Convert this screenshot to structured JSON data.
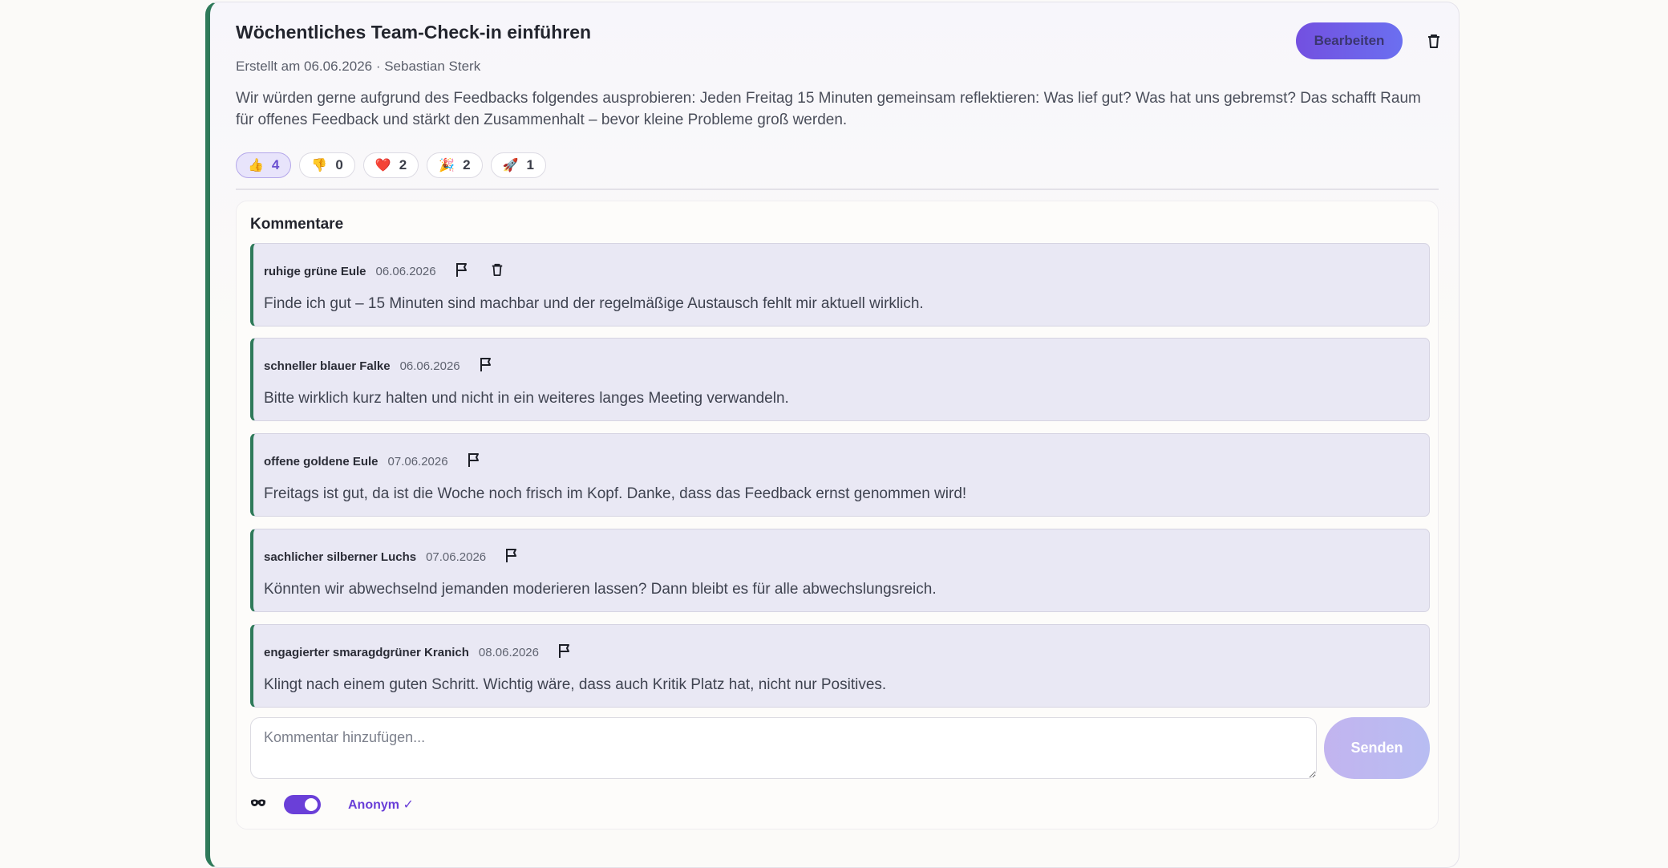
{
  "post": {
    "title": "Wöchentliches Team-Check-in einführen",
    "meta": "Erstellt am 06.06.2026 · Sebastian Sterk",
    "description": "Wir würden gerne aufgrund des Feedbacks folgendes ausprobieren: Jeden Freitag 15 Minuten gemeinsam reflektieren: Was lief gut? Was hat uns gebremst? Das schafft Raum für offenes Feedback und stärkt den Zusammenhalt – bevor kleine Probleme groß werden.",
    "edit_label": "Bearbeiten"
  },
  "reactions": [
    {
      "emoji": "👍",
      "count": "4",
      "icon": "thumbs-up-icon",
      "active": true
    },
    {
      "emoji": "👎",
      "count": "0",
      "icon": "thumbs-down-icon",
      "active": false
    },
    {
      "emoji": "❤️",
      "count": "2",
      "icon": "heart-icon",
      "active": false
    },
    {
      "emoji": "🎉",
      "count": "2",
      "icon": "party-popper-icon",
      "active": false
    },
    {
      "emoji": "🚀",
      "count": "1",
      "icon": "rocket-icon",
      "active": false
    }
  ],
  "comments": {
    "heading": "Kommentare",
    "items": [
      {
        "author": "ruhige grüne Eule",
        "date": "06.06.2026",
        "text": "Finde ich gut – 15 Minuten sind machbar und der regelmäßige Austausch fehlt mir aktuell wirklich.",
        "deletable": true
      },
      {
        "author": "schneller blauer Falke",
        "date": "06.06.2026",
        "text": "Bitte wirklich kurz halten und nicht in ein weiteres langes Meeting verwandeln.",
        "deletable": false
      },
      {
        "author": "offene goldene Eule",
        "date": "07.06.2026",
        "text": "Freitags ist gut, da ist die Woche noch frisch im Kopf. Danke, dass das Feedback ernst genommen wird!",
        "deletable": false
      },
      {
        "author": "sachlicher silberner Luchs",
        "date": "07.06.2026",
        "text": "Könnten wir abwechselnd jemanden moderieren lassen? Dann bleibt es für alle abwechslungsreich.",
        "deletable": false
      },
      {
        "author": "engagierter smaragdgrüner Kranich",
        "date": "08.06.2026",
        "text": "Klingt nach einem guten Schritt. Wichtig wäre, dass auch Kritik Platz hat, nicht nur Positives.",
        "deletable": false
      }
    ],
    "input_placeholder": "Kommentar hinzufügen...",
    "input_value": "",
    "send_label": "Senden",
    "anonymous_label": "Anonym ✓",
    "anonymous_on": true
  },
  "icons": {
    "delete": "trash-icon",
    "flag": "flag-icon",
    "anonymous": "mask-icon"
  },
  "colors": {
    "accent": "#6a3fd8",
    "card_border": "#2f7a5a",
    "comment_bg": "#e9e8f4"
  }
}
